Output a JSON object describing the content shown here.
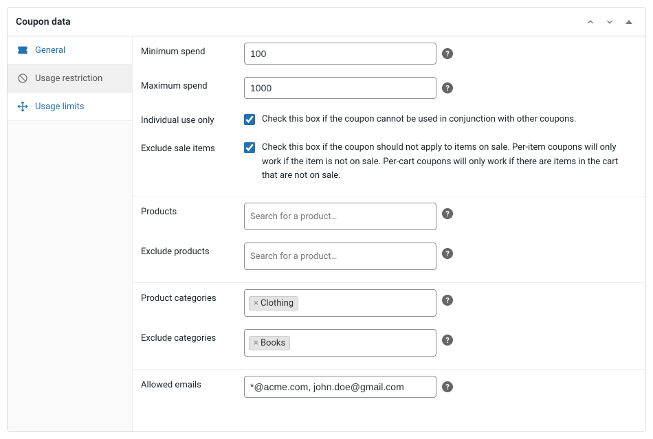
{
  "panel": {
    "title": "Coupon data"
  },
  "tabs": {
    "general": "General",
    "usage_restriction": "Usage restriction",
    "usage_limits": "Usage limits"
  },
  "fields": {
    "min_spend_label": "Minimum spend",
    "min_spend_value": "100",
    "max_spend_label": "Maximum spend",
    "max_spend_value": "1000",
    "individual_label": "Individual use only",
    "individual_desc": "Check this box if the coupon cannot be used in conjunction with other coupons.",
    "exclude_sale_label": "Exclude sale items",
    "exclude_sale_desc": "Check this box if the coupon should not apply to items on sale. Per-item coupons will only work if the item is not on sale. Per-cart coupons will only work if there are items in the cart that are not on sale.",
    "products_label": "Products",
    "products_placeholder": "Search for a product…",
    "exclude_products_label": "Exclude products",
    "exclude_products_placeholder": "Search for a product…",
    "product_cats_label": "Product categories",
    "product_cats_tags": [
      "Clothing"
    ],
    "exclude_cats_label": "Exclude categories",
    "exclude_cats_tags": [
      "Books"
    ],
    "allowed_emails_label": "Allowed emails",
    "allowed_emails_value": "*@acme.com, john.doe@gmail.com"
  }
}
